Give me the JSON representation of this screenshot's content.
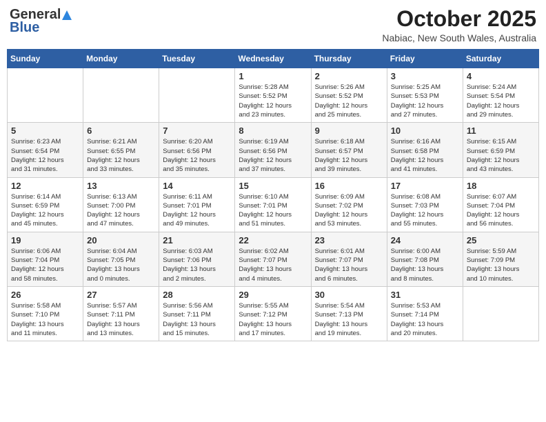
{
  "header": {
    "logo_line1": "General",
    "logo_line2": "Blue",
    "month": "October 2025",
    "location": "Nabiac, New South Wales, Australia"
  },
  "weekdays": [
    "Sunday",
    "Monday",
    "Tuesday",
    "Wednesday",
    "Thursday",
    "Friday",
    "Saturday"
  ],
  "weeks": [
    [
      {
        "day": "",
        "info": ""
      },
      {
        "day": "",
        "info": ""
      },
      {
        "day": "",
        "info": ""
      },
      {
        "day": "1",
        "info": "Sunrise: 5:28 AM\nSunset: 5:52 PM\nDaylight: 12 hours\nand 23 minutes."
      },
      {
        "day": "2",
        "info": "Sunrise: 5:26 AM\nSunset: 5:52 PM\nDaylight: 12 hours\nand 25 minutes."
      },
      {
        "day": "3",
        "info": "Sunrise: 5:25 AM\nSunset: 5:53 PM\nDaylight: 12 hours\nand 27 minutes."
      },
      {
        "day": "4",
        "info": "Sunrise: 5:24 AM\nSunset: 5:54 PM\nDaylight: 12 hours\nand 29 minutes."
      }
    ],
    [
      {
        "day": "5",
        "info": "Sunrise: 6:23 AM\nSunset: 6:54 PM\nDaylight: 12 hours\nand 31 minutes."
      },
      {
        "day": "6",
        "info": "Sunrise: 6:21 AM\nSunset: 6:55 PM\nDaylight: 12 hours\nand 33 minutes."
      },
      {
        "day": "7",
        "info": "Sunrise: 6:20 AM\nSunset: 6:56 PM\nDaylight: 12 hours\nand 35 minutes."
      },
      {
        "day": "8",
        "info": "Sunrise: 6:19 AM\nSunset: 6:56 PM\nDaylight: 12 hours\nand 37 minutes."
      },
      {
        "day": "9",
        "info": "Sunrise: 6:18 AM\nSunset: 6:57 PM\nDaylight: 12 hours\nand 39 minutes."
      },
      {
        "day": "10",
        "info": "Sunrise: 6:16 AM\nSunset: 6:58 PM\nDaylight: 12 hours\nand 41 minutes."
      },
      {
        "day": "11",
        "info": "Sunrise: 6:15 AM\nSunset: 6:59 PM\nDaylight: 12 hours\nand 43 minutes."
      }
    ],
    [
      {
        "day": "12",
        "info": "Sunrise: 6:14 AM\nSunset: 6:59 PM\nDaylight: 12 hours\nand 45 minutes."
      },
      {
        "day": "13",
        "info": "Sunrise: 6:13 AM\nSunset: 7:00 PM\nDaylight: 12 hours\nand 47 minutes."
      },
      {
        "day": "14",
        "info": "Sunrise: 6:11 AM\nSunset: 7:01 PM\nDaylight: 12 hours\nand 49 minutes."
      },
      {
        "day": "15",
        "info": "Sunrise: 6:10 AM\nSunset: 7:01 PM\nDaylight: 12 hours\nand 51 minutes."
      },
      {
        "day": "16",
        "info": "Sunrise: 6:09 AM\nSunset: 7:02 PM\nDaylight: 12 hours\nand 53 minutes."
      },
      {
        "day": "17",
        "info": "Sunrise: 6:08 AM\nSunset: 7:03 PM\nDaylight: 12 hours\nand 55 minutes."
      },
      {
        "day": "18",
        "info": "Sunrise: 6:07 AM\nSunset: 7:04 PM\nDaylight: 12 hours\nand 56 minutes."
      }
    ],
    [
      {
        "day": "19",
        "info": "Sunrise: 6:06 AM\nSunset: 7:04 PM\nDaylight: 12 hours\nand 58 minutes."
      },
      {
        "day": "20",
        "info": "Sunrise: 6:04 AM\nSunset: 7:05 PM\nDaylight: 13 hours\nand 0 minutes."
      },
      {
        "day": "21",
        "info": "Sunrise: 6:03 AM\nSunset: 7:06 PM\nDaylight: 13 hours\nand 2 minutes."
      },
      {
        "day": "22",
        "info": "Sunrise: 6:02 AM\nSunset: 7:07 PM\nDaylight: 13 hours\nand 4 minutes."
      },
      {
        "day": "23",
        "info": "Sunrise: 6:01 AM\nSunset: 7:07 PM\nDaylight: 13 hours\nand 6 minutes."
      },
      {
        "day": "24",
        "info": "Sunrise: 6:00 AM\nSunset: 7:08 PM\nDaylight: 13 hours\nand 8 minutes."
      },
      {
        "day": "25",
        "info": "Sunrise: 5:59 AM\nSunset: 7:09 PM\nDaylight: 13 hours\nand 10 minutes."
      }
    ],
    [
      {
        "day": "26",
        "info": "Sunrise: 5:58 AM\nSunset: 7:10 PM\nDaylight: 13 hours\nand 11 minutes."
      },
      {
        "day": "27",
        "info": "Sunrise: 5:57 AM\nSunset: 7:11 PM\nDaylight: 13 hours\nand 13 minutes."
      },
      {
        "day": "28",
        "info": "Sunrise: 5:56 AM\nSunset: 7:11 PM\nDaylight: 13 hours\nand 15 minutes."
      },
      {
        "day": "29",
        "info": "Sunrise: 5:55 AM\nSunset: 7:12 PM\nDaylight: 13 hours\nand 17 minutes."
      },
      {
        "day": "30",
        "info": "Sunrise: 5:54 AM\nSunset: 7:13 PM\nDaylight: 13 hours\nand 19 minutes."
      },
      {
        "day": "31",
        "info": "Sunrise: 5:53 AM\nSunset: 7:14 PM\nDaylight: 13 hours\nand 20 minutes."
      },
      {
        "day": "",
        "info": ""
      }
    ]
  ]
}
